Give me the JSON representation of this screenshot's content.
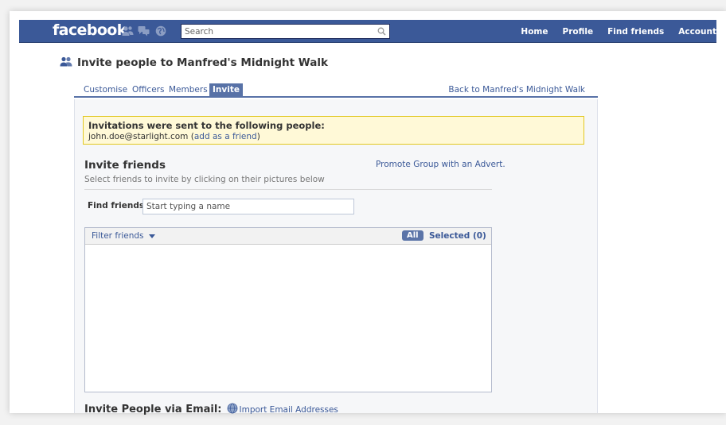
{
  "colors": {
    "brand": "#3b5998",
    "tab_active": "#5872a7",
    "notice_bg": "#fff9d7",
    "notice_border": "#e2c822"
  },
  "topbar": {
    "logo": "facebook",
    "jewels": [
      "friend-requests-icon",
      "messages-icon",
      "notifications-icon"
    ],
    "search": {
      "placeholder": "Search",
      "icon": "search-icon"
    },
    "nav": [
      "Home",
      "Profile",
      "Find friends",
      "Account"
    ]
  },
  "page": {
    "title": "Invite people to Manfred's Midnight Walk",
    "title_icon": "group-icon"
  },
  "tabs": {
    "items": [
      {
        "label": "Customise",
        "active": false
      },
      {
        "label": "Officers",
        "active": false
      },
      {
        "label": "Members",
        "active": false
      },
      {
        "label": "Invite",
        "active": true
      }
    ],
    "back_link": "Back to Manfred's Midnight Walk"
  },
  "notice": {
    "title": "Invitations were sent to the following people:",
    "email": "john.doe@starlight.com",
    "add_friend_label": "add as a friend"
  },
  "invite_friends": {
    "title": "Invite friends",
    "subtitle": "Select friends to invite by clicking on their pictures below",
    "promote_link": "Promote Group with an Advert.",
    "find_label": "Find friends",
    "find_placeholder": "Start typing a name",
    "filter_label": "Filter friends",
    "all_label": "All",
    "selected_label": "Selected (0)"
  },
  "invite_email": {
    "title": "Invite People via Email:",
    "import_label": "Import Email Addresses"
  }
}
